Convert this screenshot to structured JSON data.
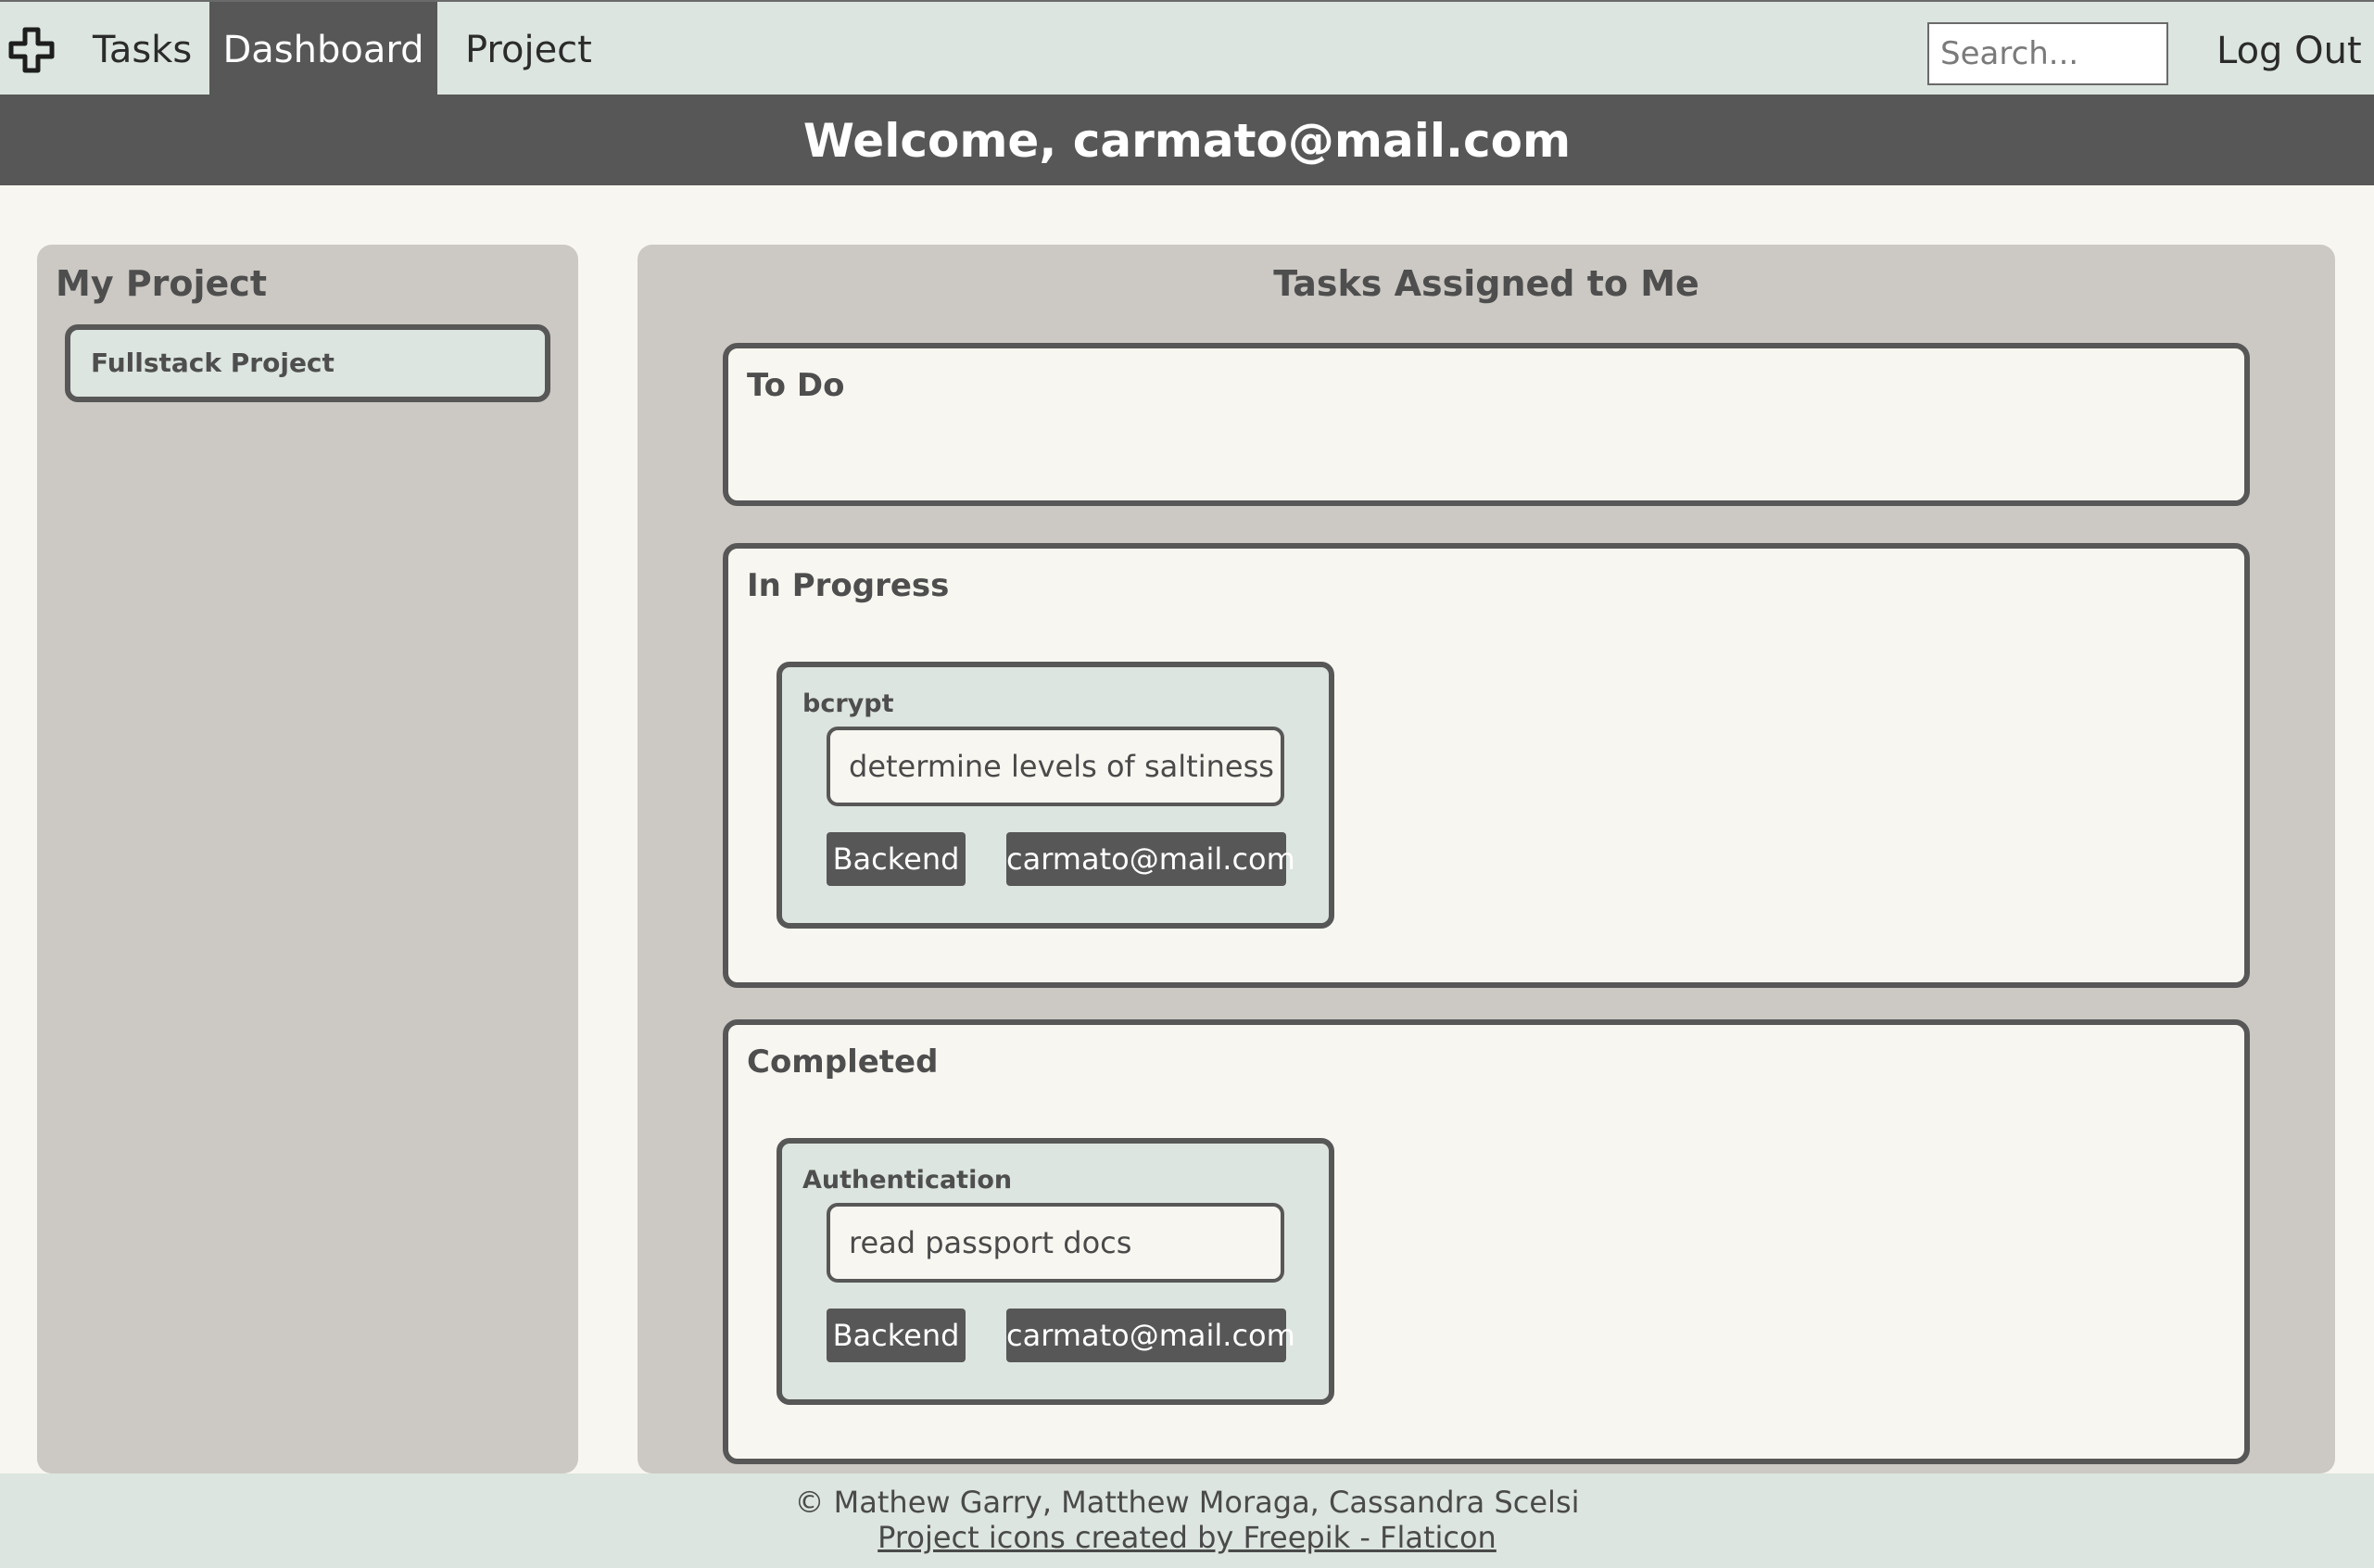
{
  "nav": {
    "logo_icon": "plus-cross-icon",
    "items": [
      {
        "label": "Tasks",
        "active": false
      },
      {
        "label": "Dashboard",
        "active": true
      },
      {
        "label": "Project",
        "active": false
      }
    ],
    "search_placeholder": "Search...",
    "logout_label": "Log Out"
  },
  "welcome": {
    "text": "Welcome, carmato@mail.com"
  },
  "sidebar": {
    "title": "My Project",
    "projects": [
      {
        "name": "Fullstack Project"
      }
    ]
  },
  "main": {
    "title": "Tasks Assigned to Me",
    "columns": [
      {
        "title": "To Do",
        "tasks": []
      },
      {
        "title": "In Progress",
        "tasks": [
          {
            "title": "bcrypt",
            "description": "determine levels of saltiness",
            "category": "Backend",
            "assignee": "carmato@mail.com"
          }
        ]
      },
      {
        "title": "Completed",
        "tasks": [
          {
            "title": "Authentication",
            "description": "read passport docs",
            "category": "Backend",
            "assignee": "carmato@mail.com"
          }
        ]
      }
    ]
  },
  "footer": {
    "copyright": "© Mathew Garry, Matthew Moraga, Cassandra Scelsi",
    "credit_link": "Project icons created by Freepik - Flaticon"
  },
  "colors": {
    "nav_bg": "#dce5df",
    "dark": "#575757",
    "panel_bg": "#ccc8c3",
    "page_bg": "#f8f6f0"
  }
}
